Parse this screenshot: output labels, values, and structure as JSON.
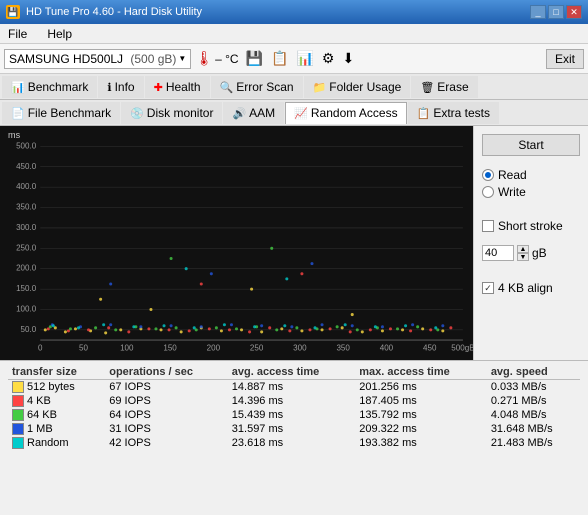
{
  "titleBar": {
    "title": "HD Tune Pro 4.60 - Hard Disk Utility",
    "icon": "💾"
  },
  "menuBar": {
    "items": [
      "File",
      "Help"
    ]
  },
  "toolbar": {
    "drive": "SAMSUNG HD500LJ",
    "driveSize": "(500 gB)",
    "tempSymbol": "– °C",
    "exitLabel": "Exit"
  },
  "tabs": {
    "row1": [
      {
        "label": "Benchmark",
        "icon": "📊",
        "active": false
      },
      {
        "label": "Info",
        "icon": "ℹ",
        "active": false
      },
      {
        "label": "Health",
        "icon": "➕",
        "active": false
      },
      {
        "label": "Error Scan",
        "icon": "🔍",
        "active": false
      },
      {
        "label": "Folder Usage",
        "icon": "📁",
        "active": false
      },
      {
        "label": "Erase",
        "icon": "🗑",
        "active": false
      }
    ],
    "row2": [
      {
        "label": "File Benchmark",
        "icon": "📄",
        "active": false
      },
      {
        "label": "Disk monitor",
        "icon": "💿",
        "active": false
      },
      {
        "label": "AAM",
        "icon": "🔊",
        "active": false
      },
      {
        "label": "Random Access",
        "icon": "📈",
        "active": true
      },
      {
        "label": "Extra tests",
        "icon": "📋",
        "active": false
      }
    ]
  },
  "rightPanel": {
    "startLabel": "Start",
    "radioOptions": [
      "Read",
      "Write"
    ],
    "selectedRadio": "Read",
    "shortStroke": "Short stroke",
    "strokeValue": "40",
    "strokeUnit": "gB",
    "alignLabel": "4 KB align",
    "alignChecked": true
  },
  "chart": {
    "yLabel": "ms",
    "yTicks": [
      "500.0",
      "450.0",
      "400.0",
      "350.0",
      "300.0",
      "250.0",
      "200.0",
      "150.0",
      "100.0",
      "50.0"
    ],
    "xTicks": [
      "0",
      "50",
      "100",
      "150",
      "200",
      "250",
      "300",
      "350",
      "400",
      "450",
      "500gB"
    ]
  },
  "dataTable": {
    "headers": [
      "transfer size",
      "operations / sec",
      "avg. access time",
      "max. access time",
      "avg. speed"
    ],
    "rows": [
      {
        "color": "#ffdd44",
        "colorBox": "yellow",
        "label": "512 bytes",
        "ops": "67 IOPS",
        "avg": "14.887 ms",
        "max": "201.256 ms",
        "speed": "0.033 MB/s"
      },
      {
        "color": "#ff2222",
        "colorBox": "red",
        "label": "4 KB",
        "ops": "69 IOPS",
        "avg": "14.396 ms",
        "max": "187.405 ms",
        "speed": "0.271 MB/s"
      },
      {
        "color": "#44aa44",
        "colorBox": "green",
        "label": "64 KB",
        "ops": "64 IOPS",
        "avg": "15.439 ms",
        "max": "135.792 ms",
        "speed": "4.048 MB/s"
      },
      {
        "color": "#2244cc",
        "colorBox": "blue",
        "label": "1 MB",
        "ops": "31 IOPS",
        "avg": "31.597 ms",
        "max": "209.322 ms",
        "speed": "31.648 MB/s"
      },
      {
        "color": "#00cccc",
        "colorBox": "cyan",
        "label": "Random",
        "ops": "42 IOPS",
        "avg": "23.618 ms",
        "max": "193.382 ms",
        "speed": "21.483 MB/s"
      }
    ]
  }
}
